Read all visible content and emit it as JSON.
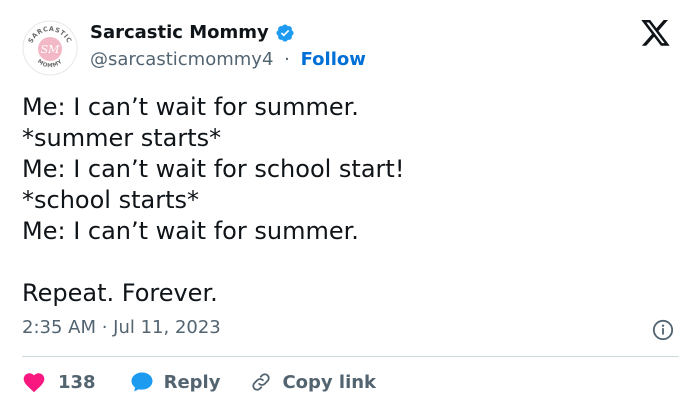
{
  "author": {
    "name": "Sarcastic Mommy",
    "handle": "@sarcasticmommy4",
    "separator": "·",
    "follow_label": "Follow",
    "avatar_icon": "sarcastic-mommy-logo",
    "avatar_text_top": "SARCASTIC",
    "avatar_text_bottom": "MOMMY",
    "avatar_initials": "SM"
  },
  "tweet": {
    "lines": [
      "Me: I can’t wait for summer.",
      "*summer starts*",
      "Me: I can’t wait for school start!",
      "*school starts*",
      "Me: I can’t wait for summer.",
      "",
      "Repeat. Forever."
    ]
  },
  "meta": {
    "timestamp": "2:35 AM · Jul 11, 2023"
  },
  "actions": {
    "like_count": "138",
    "reply_label": "Reply",
    "copy_label": "Copy link"
  },
  "colors": {
    "text": "#0f1419",
    "secondary": "#536471",
    "link": "#006fd6",
    "verified": "#1d9bf0",
    "like": "#f91880",
    "reply": "#1d9bf0",
    "divider": "#cfd9de",
    "avatar_pink": "#f2b8c6"
  }
}
